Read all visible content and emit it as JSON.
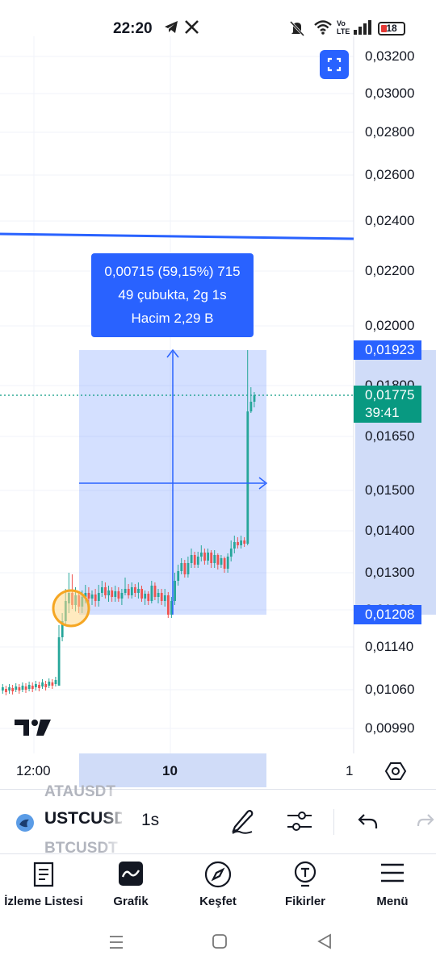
{
  "status_bar": {
    "time": "22:20",
    "vo_lte": "Vo LTE",
    "battery_level": "18",
    "icons": [
      "telegram-icon",
      "x-icon",
      "mute-icon",
      "wifi-icon",
      "signal-icon",
      "battery-icon"
    ]
  },
  "chart": {
    "price_axis": [
      "0,03200",
      "0,03000",
      "0,02800",
      "0,02600",
      "0,02400",
      "0,02200",
      "0,02000",
      "0,01800",
      "0,01650",
      "0,01500",
      "0,01400",
      "0,01300",
      "0,01200",
      "0,01140",
      "0,01060",
      "0,00990"
    ],
    "range_top_price": "0,01923",
    "range_bottom_price": "0,01208",
    "current_price": "0,01775",
    "countdown": "39:41",
    "time_axis": [
      "12:00",
      "10",
      "1"
    ],
    "measure_info": {
      "line1": "0,00715 (59,15%) 715",
      "line2": "49 çubukta, 2g 1s",
      "line3": "Hacim 2,29 B"
    },
    "colors": {
      "up": "#26a69a",
      "down": "#ef5350",
      "accent": "#2962ff",
      "current_tag": "#089981"
    }
  },
  "toolbar": {
    "symbol": "USTCUSDT",
    "symbol_prev": "ATAUSDT",
    "symbol_next": "BTCUSDT",
    "interval": "1s"
  },
  "bottom_nav": [
    {
      "label": "İzleme Listesi",
      "icon": "watchlist-icon"
    },
    {
      "label": "Grafik",
      "icon": "chart-icon"
    },
    {
      "label": "Keşfet",
      "icon": "compass-icon"
    },
    {
      "label": "Fikirler",
      "icon": "ideas-icon"
    },
    {
      "label": "Menü",
      "icon": "menu-icon"
    }
  ]
}
